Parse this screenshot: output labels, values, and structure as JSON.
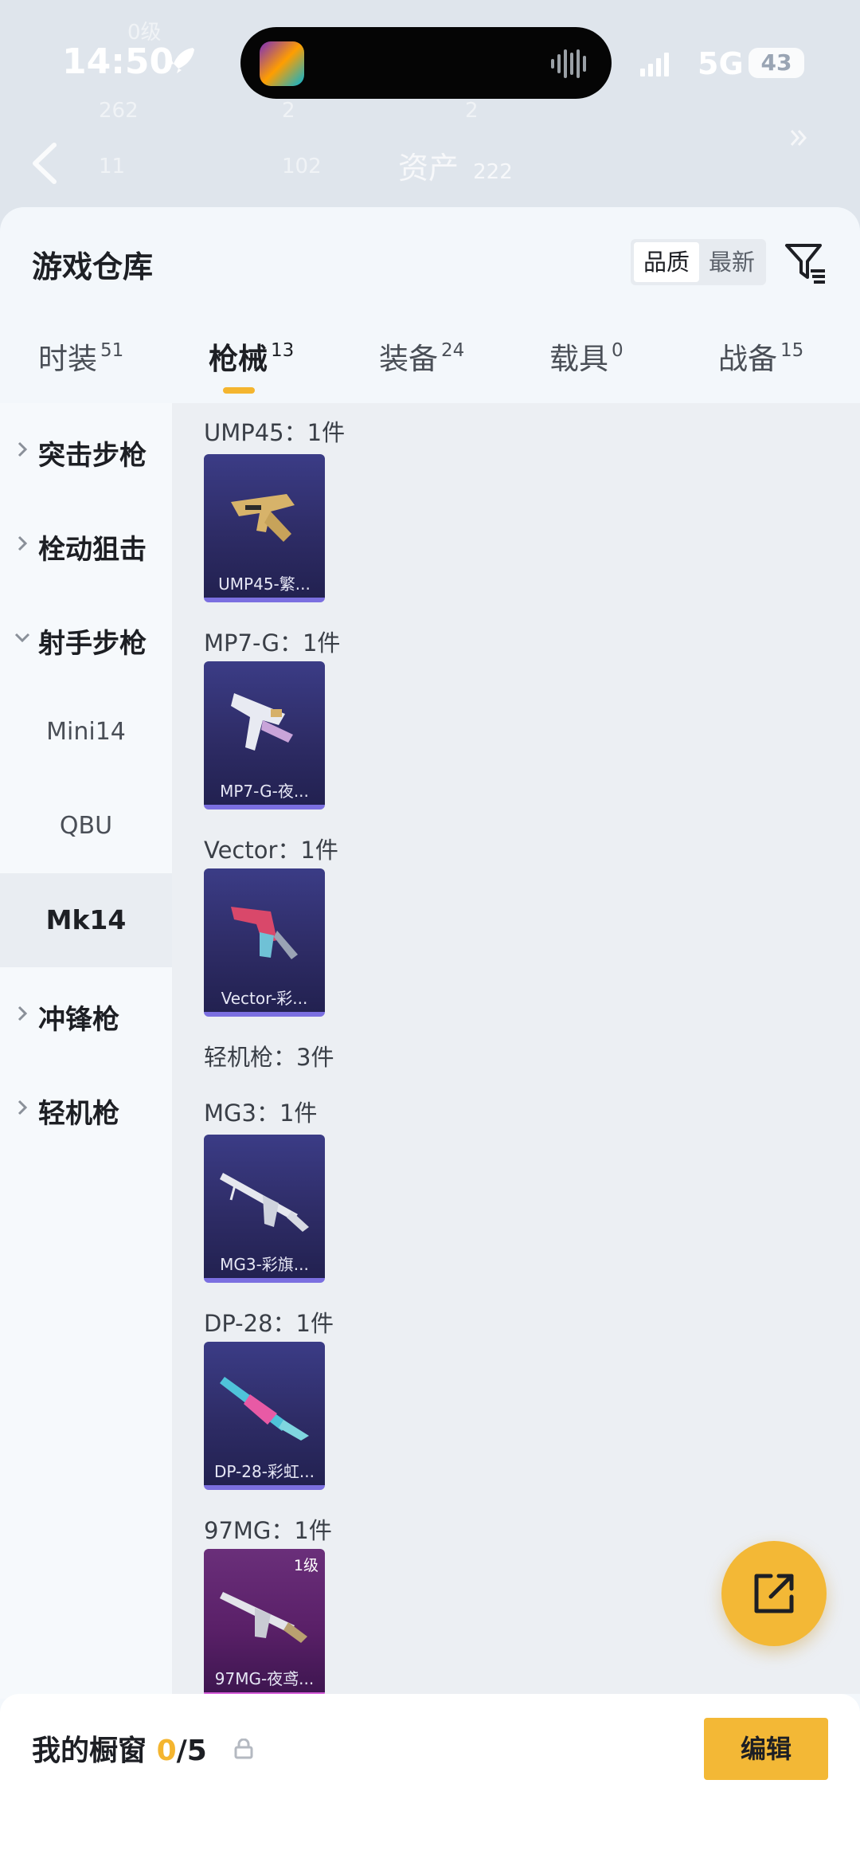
{
  "status_bar": {
    "time": "14:50",
    "network": "5G",
    "battery": "43"
  },
  "background_header": {
    "title": "资产",
    "title_count": "222",
    "level_text": "0级",
    "stats": [
      "262",
      "2",
      "2"
    ],
    "stats_row2": [
      "11",
      "102"
    ]
  },
  "sheet": {
    "title": "游戏仓库",
    "sort": {
      "quality": "品质",
      "newest": "最新",
      "active": "quality"
    }
  },
  "tabs": [
    {
      "label": "时装",
      "count": "51",
      "active": false
    },
    {
      "label": "枪械",
      "count": "13",
      "active": true
    },
    {
      "label": "装备",
      "count": "24",
      "active": false
    },
    {
      "label": "载具",
      "count": "0",
      "active": false
    },
    {
      "label": "战备",
      "count": "15",
      "active": false
    }
  ],
  "categories": [
    {
      "label": "突击步枪",
      "expanded": false
    },
    {
      "label": "栓动狙击",
      "expanded": false
    },
    {
      "label": "射手步枪",
      "expanded": true,
      "children": [
        "Mini14",
        "QBU",
        "Mk14"
      ],
      "selected_child": "Mk14"
    },
    {
      "label": "冲锋枪",
      "expanded": false
    },
    {
      "label": "轻机枪",
      "expanded": false
    }
  ],
  "groups": [
    {
      "title": "UMP45：1件",
      "item": {
        "name": "UMP45-繁...",
        "rarity": "purple"
      }
    },
    {
      "title": "MP7-G：1件",
      "item": {
        "name": "MP7-G-夜...",
        "rarity": "purple"
      }
    },
    {
      "title": "Vector：1件",
      "item": {
        "name": "Vector-彩...",
        "rarity": "purple"
      }
    },
    {
      "title": "轻机枪：3件"
    },
    {
      "title": "MG3：1件",
      "item": {
        "name": "MG3-彩旗...",
        "rarity": "purple"
      }
    },
    {
      "title": "DP-28：1件",
      "item": {
        "name": "DP-28-彩虹...",
        "rarity": "purple"
      }
    },
    {
      "title": "97MG：1件",
      "item": {
        "name": "97MG-夜鸢...",
        "rarity": "pink",
        "level": "1级"
      }
    }
  ],
  "showcase": {
    "label": "我的橱窗",
    "used": "0",
    "total": "/5",
    "edit": "编辑"
  },
  "colors": {
    "accent": "#f3b836",
    "sheet_bg": "#f3f7fb",
    "card_purple": "#2e2c66",
    "card_pink": "#5a2068"
  },
  "icons": [
    "rocket-icon",
    "signal-icon",
    "back-icon",
    "more-icon",
    "filter-icon",
    "chevron-right-icon",
    "chevron-down-icon",
    "share-icon",
    "lock-icon"
  ]
}
